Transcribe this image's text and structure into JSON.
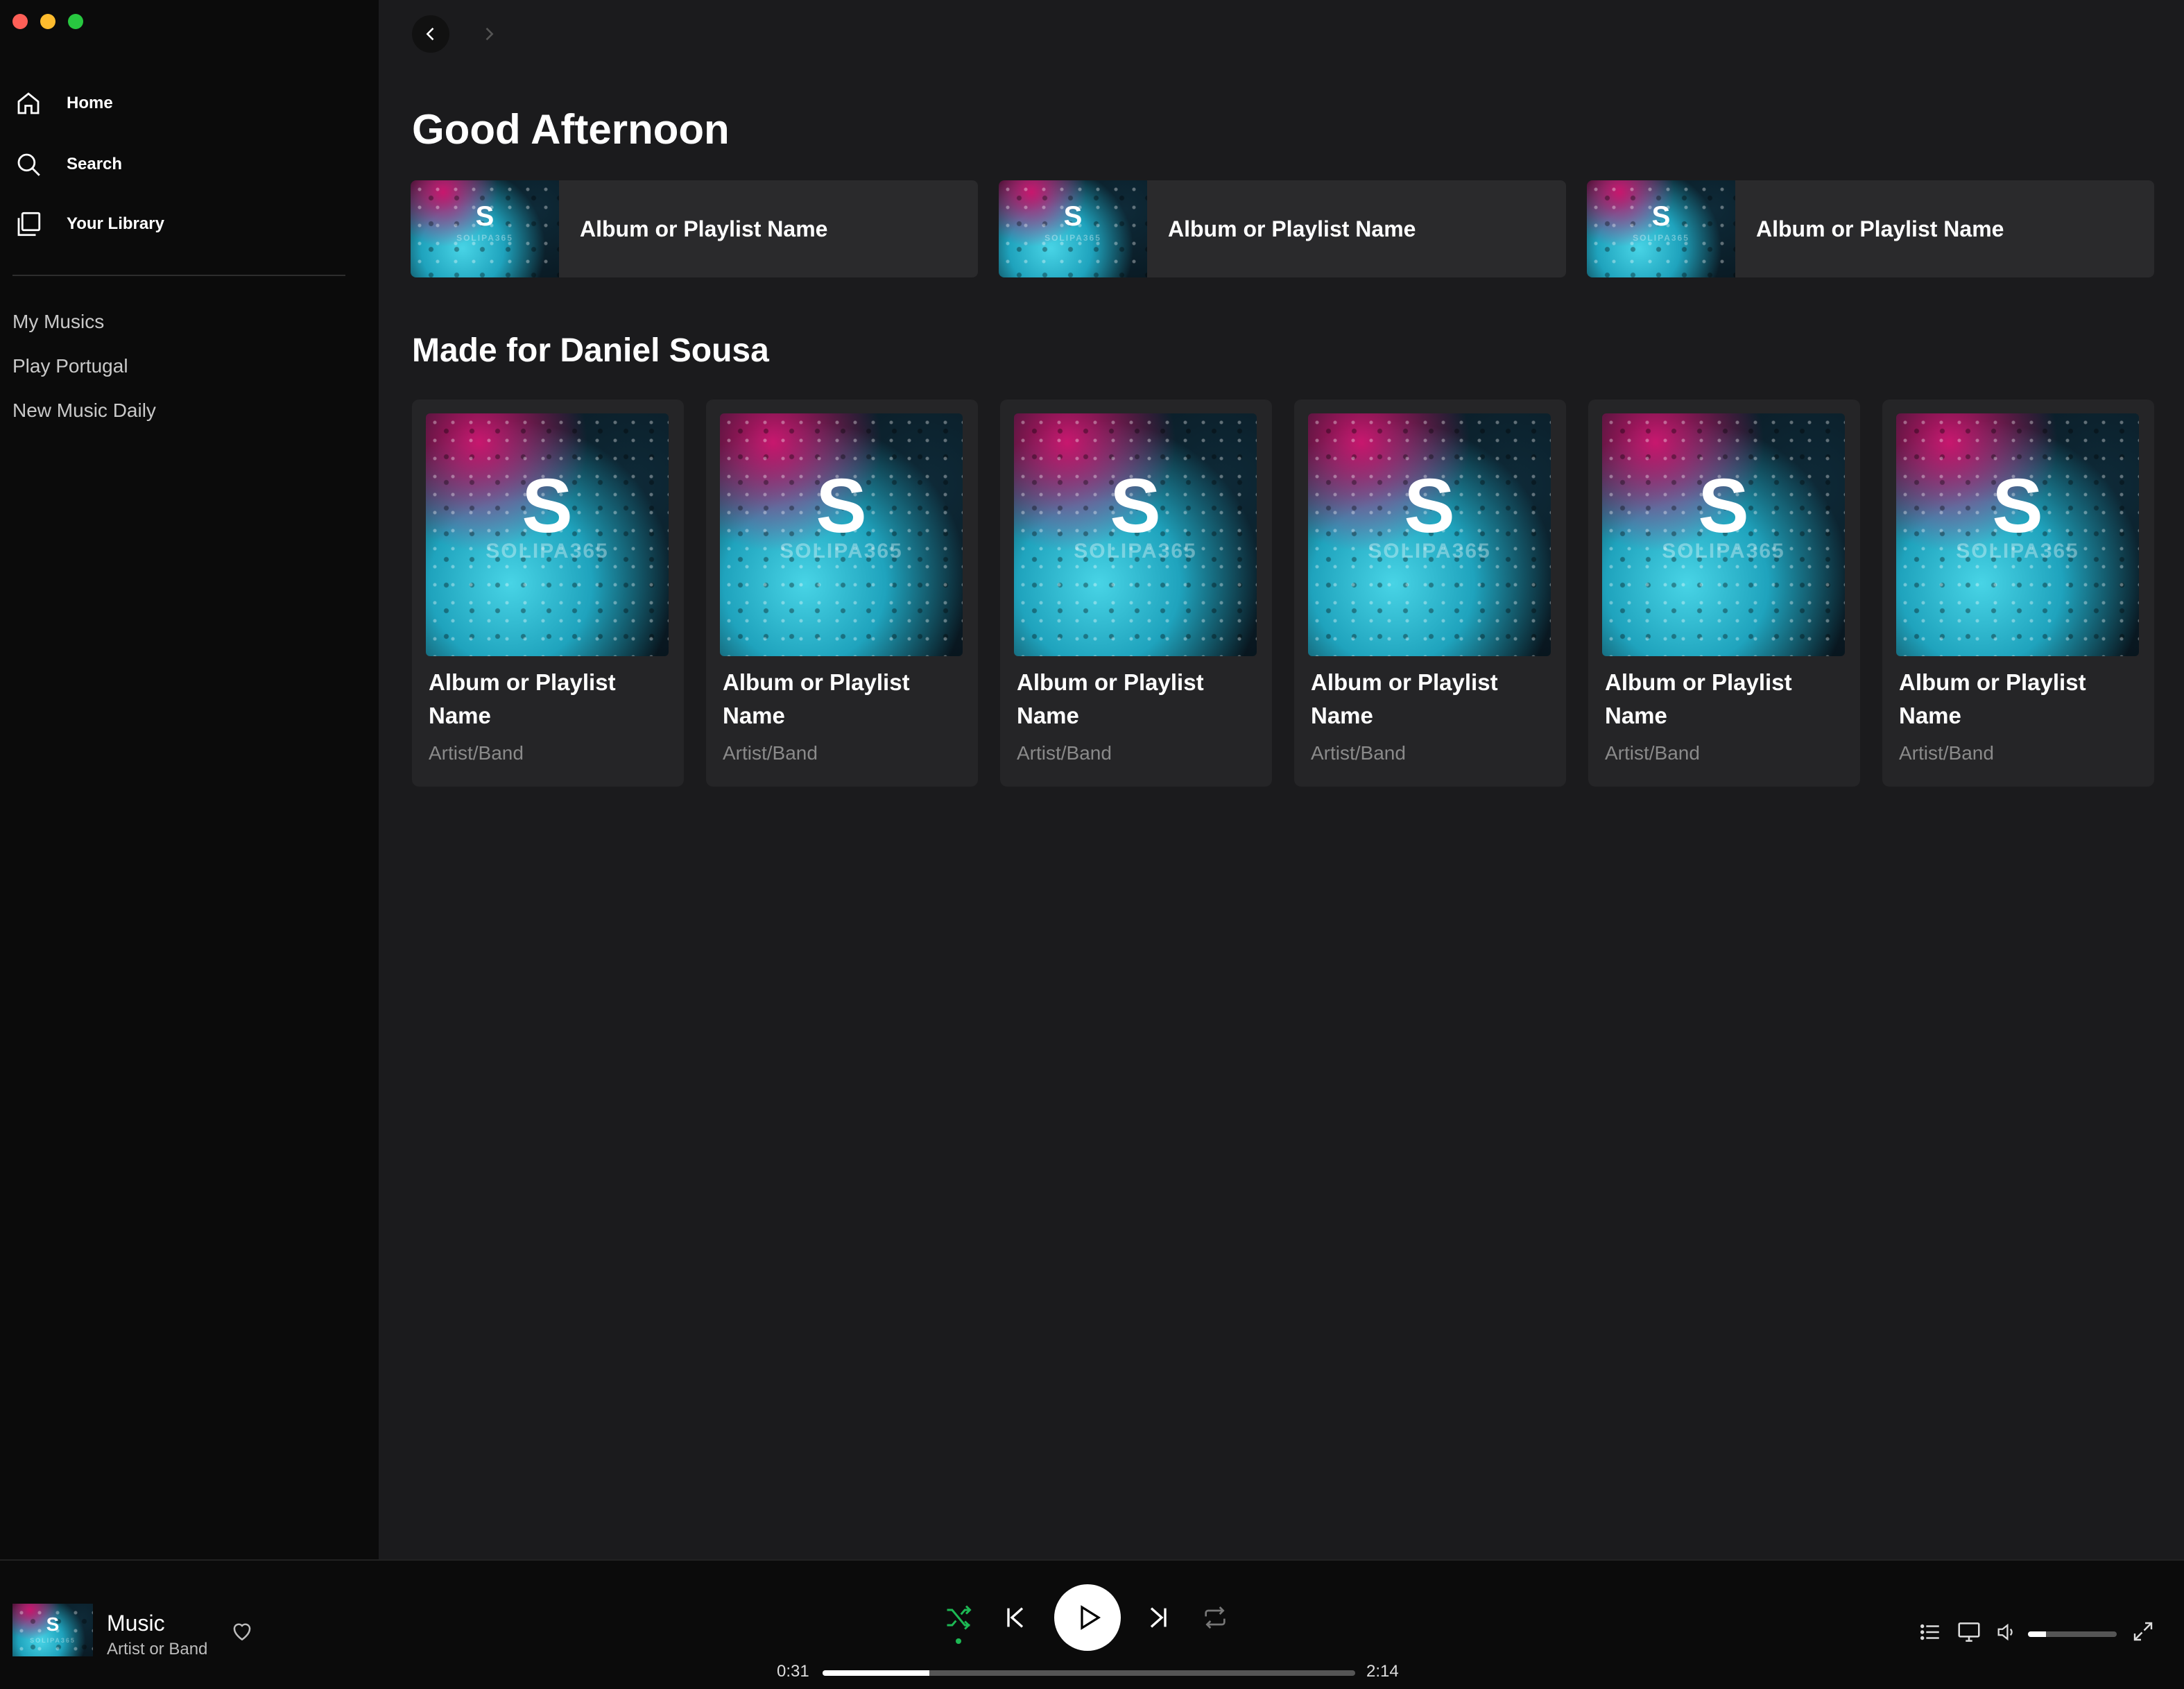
{
  "sidebar": {
    "nav": [
      {
        "label": "Home",
        "icon": "home-icon"
      },
      {
        "label": "Search",
        "icon": "search-icon"
      },
      {
        "label": "Your Library",
        "icon": "library-icon"
      }
    ],
    "playlists": [
      "My Musics",
      "Play Portugal",
      "New Music Daily"
    ]
  },
  "cover": {
    "letter": "S",
    "wordmark": "SOLIPA365"
  },
  "main": {
    "greeting": "Good Afternoon",
    "quick_items": [
      {
        "title": "Album or Playlist Name"
      },
      {
        "title": "Album or Playlist Name"
      },
      {
        "title": "Album or Playlist Name"
      }
    ],
    "section_title": "Made for Daniel Sousa",
    "cards": [
      {
        "title": "Album or Playlist Name",
        "subtitle": "Artist/Band"
      },
      {
        "title": "Album or Playlist Name",
        "subtitle": "Artist/Band"
      },
      {
        "title": "Album or Playlist Name",
        "subtitle": "Artist/Band"
      },
      {
        "title": "Album or Playlist Name",
        "subtitle": "Artist/Band"
      },
      {
        "title": "Album or Playlist Name",
        "subtitle": "Artist/Band"
      },
      {
        "title": "Album or Playlist Name",
        "subtitle": "Artist/Band"
      }
    ]
  },
  "player": {
    "track_title": "Music",
    "artist": "Artist or Band",
    "elapsed": "0:31",
    "duration": "2:14",
    "progress_fraction": 0.2,
    "volume_fraction": 0.2,
    "shuffle_active": true
  },
  "colors": {
    "accent": "#1db954",
    "background": "#1b1b1d",
    "sidebar": "#0b0b0b"
  }
}
